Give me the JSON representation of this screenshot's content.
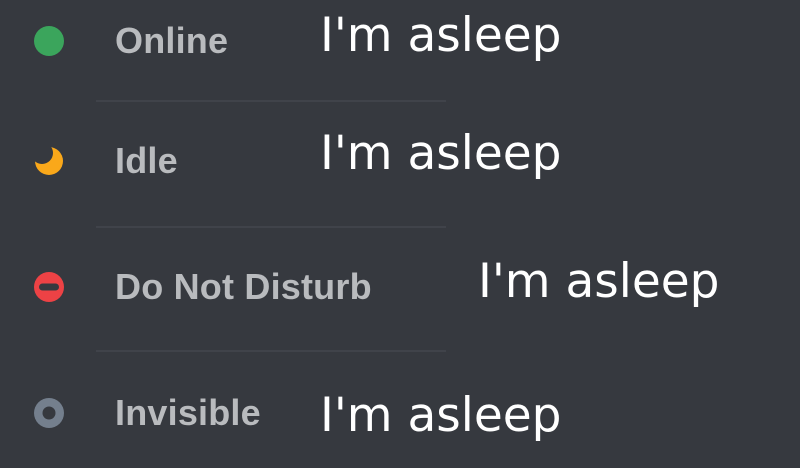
{
  "status_menu": {
    "items": [
      {
        "icon": "online-dot-icon",
        "label": "Online",
        "caption": "I'm asleep",
        "color": "#3ba55c"
      },
      {
        "icon": "idle-moon-icon",
        "label": "Idle",
        "caption": "I'm asleep",
        "color": "#faa81a"
      },
      {
        "icon": "do-not-disturb-icon",
        "label": "Do Not Disturb",
        "caption": "I'm asleep",
        "color": "#ed4245"
      },
      {
        "icon": "invisible-ring-icon",
        "label": "Invisible",
        "caption": "I'm asleep",
        "color": "#747f8d"
      }
    ]
  },
  "colors": {
    "background": "#36393f",
    "label_text": "#b9bbbe",
    "caption_text": "#ffffff",
    "separator": "#40434a"
  }
}
